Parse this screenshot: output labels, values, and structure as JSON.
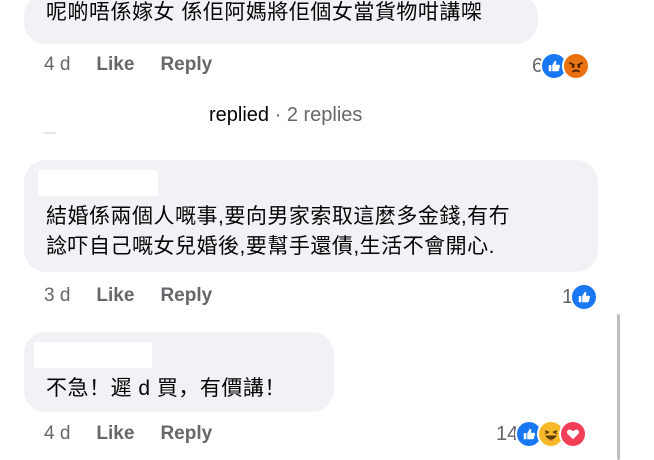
{
  "comments": [
    {
      "text": "呢啲唔係嫁女 係佢阿媽將佢個女當貨物咁講㗎",
      "time": "4 d",
      "like_label": "Like",
      "reply_label": "Reply",
      "reaction_count": "6",
      "reactions": [
        "like",
        "angry"
      ]
    },
    {
      "text": "結婚係兩個人嘅事,要向男家索取這麼多金錢,有冇\n諗吓自己嘅女兒婚後,要幫手還債,生活不會開心.",
      "time": "3 d",
      "like_label": "Like",
      "reply_label": "Reply",
      "reaction_count": "1",
      "reactions": [
        "like"
      ]
    },
    {
      "text": "不急！遲 d 買，有價講！",
      "time": "4 d",
      "like_label": "Like",
      "reply_label": "Reply",
      "reaction_count": "14",
      "reactions": [
        "like",
        "haha",
        "love"
      ]
    }
  ],
  "replies_summary": {
    "who": "replied",
    "separator": " · ",
    "count": "2 replies"
  },
  "colors": {
    "like_blue": "#1877f2",
    "angry_orange": "#e9710f",
    "haha_yellow": "#f7b928",
    "love_red": "#f33e58"
  }
}
